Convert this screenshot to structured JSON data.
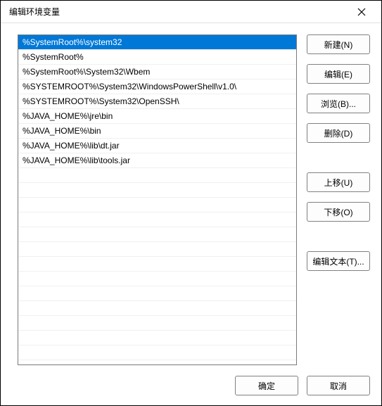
{
  "title": "编辑环境变量",
  "list": {
    "items": [
      "%SystemRoot%\\system32",
      "%SystemRoot%",
      "%SystemRoot%\\System32\\Wbem",
      "%SYSTEMROOT%\\System32\\WindowsPowerShell\\v1.0\\",
      "%SYSTEMROOT%\\System32\\OpenSSH\\",
      "%JAVA_HOME%\\jre\\bin",
      "%JAVA_HOME%\\bin",
      "%JAVA_HOME%\\lib\\dt.jar",
      "%JAVA_HOME%\\lib\\tools.jar"
    ],
    "selected_index": 0,
    "visible_rows": 22
  },
  "buttons": {
    "new": "新建(N)",
    "edit": "编辑(E)",
    "browse": "浏览(B)...",
    "delete": "删除(D)",
    "move_up": "上移(U)",
    "move_down": "下移(O)",
    "edit_text": "编辑文本(T)...",
    "ok": "确定",
    "cancel": "取消"
  }
}
